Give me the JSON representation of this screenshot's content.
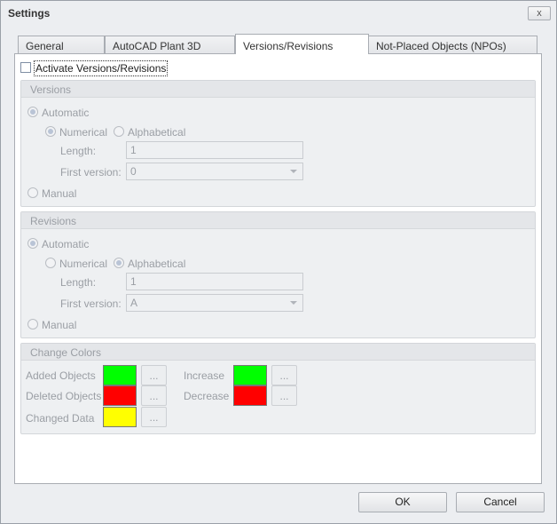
{
  "window": {
    "title": "Settings",
    "close_label": "x"
  },
  "tabs": [
    {
      "label": "General"
    },
    {
      "label": "AutoCAD Plant 3D"
    },
    {
      "label": "Versions/Revisions",
      "selected": true
    },
    {
      "label": "Not-Placed Objects (NPOs)"
    }
  ],
  "activate": {
    "label": "Activate Versions/Revisions",
    "checked": false
  },
  "versions": {
    "title": "Versions",
    "automatic": "Automatic",
    "numerical": "Numerical",
    "alphabetical": "Alphabetical",
    "length_label": "Length:",
    "length_value": "1",
    "first_label": "First version:",
    "first_value": "0",
    "manual": "Manual",
    "selected_mode": "Automatic",
    "selected_type": "Numerical"
  },
  "revisions": {
    "title": "Revisions",
    "automatic": "Automatic",
    "numerical": "Numerical",
    "alphabetical": "Alphabetical",
    "length_label": "Length:",
    "length_value": "1",
    "first_label": "First version:",
    "first_value": "A",
    "manual": "Manual",
    "selected_mode": "Automatic",
    "selected_type": "Alphabetical"
  },
  "colors": {
    "title": "Change Colors",
    "dots": "...",
    "added": {
      "label": "Added Objects",
      "color": "#00ff00"
    },
    "deleted": {
      "label": "Deleted Objects",
      "color": "#ff0000"
    },
    "changed": {
      "label": "Changed Data",
      "color": "#ffff00"
    },
    "increase": {
      "label": "Increase",
      "color": "#00ff00"
    },
    "decrease": {
      "label": "Decrease",
      "color": "#ff0000"
    }
  },
  "buttons": {
    "ok": "OK",
    "cancel": "Cancel"
  }
}
